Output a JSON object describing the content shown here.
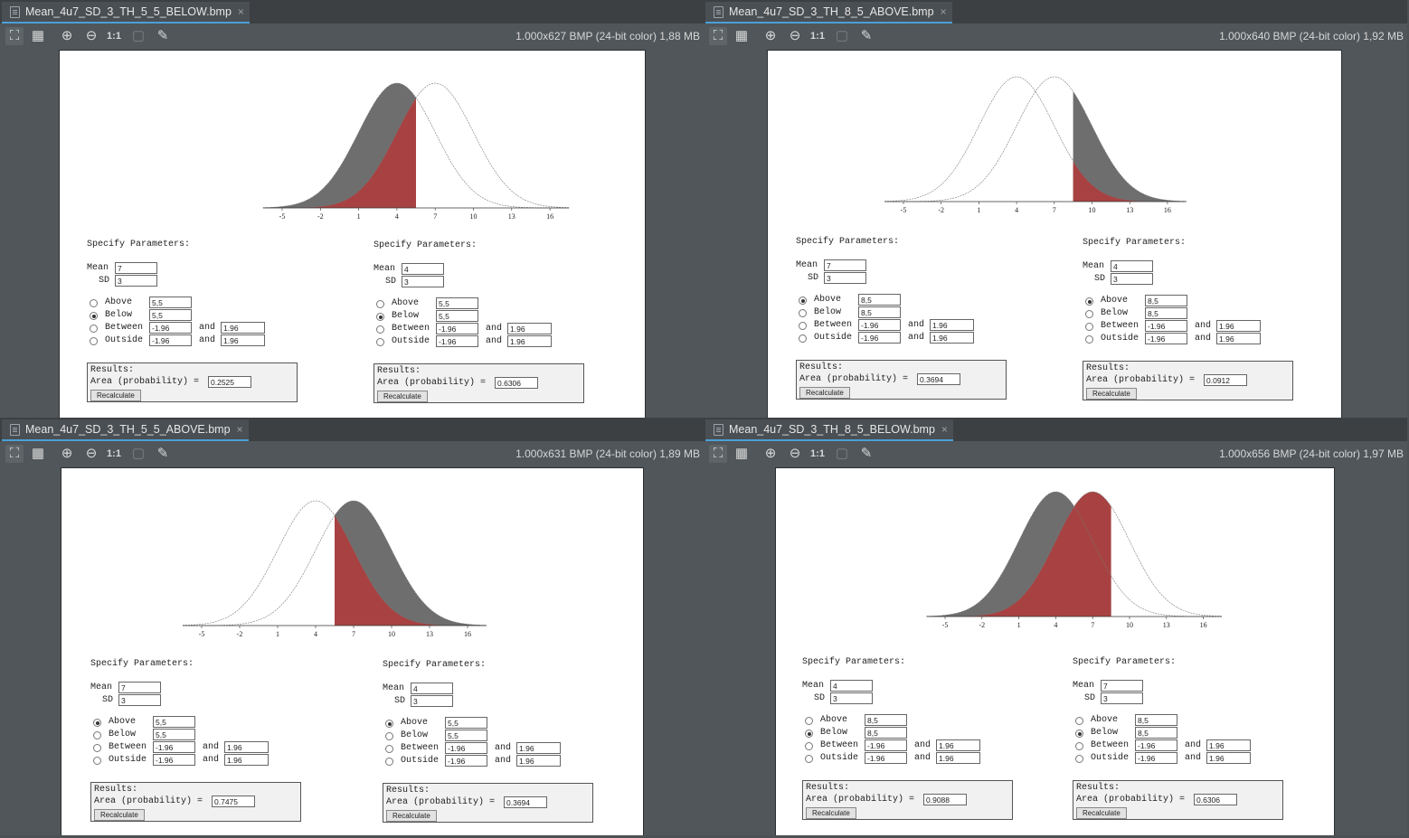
{
  "toolbar_icons": [
    "fit-icon",
    "grid-icon",
    "zoom-in-icon",
    "zoom-out-icon",
    "actual-size-icon",
    "crop-icon",
    "eyedropper-icon"
  ],
  "toolbar_actual_size_label": "1:1",
  "colors": {
    "dark_fill": "#6e6e6e",
    "red_fill": "#a84242",
    "tab_accent": "#4a9fd6"
  },
  "axis_ticks": [
    "-5",
    "-2",
    "1",
    "4",
    "7",
    "10",
    "13",
    "16"
  ],
  "form_labels": {
    "specify": "Specify Parameters:",
    "mean": "Mean",
    "sd": "SD",
    "above": "Above",
    "below": "Below",
    "between": "Between",
    "outside": "Outside",
    "and": "and",
    "results": "Results:",
    "area": "Area (probability) =",
    "recalc": "Recalculate"
  },
  "panes": [
    {
      "tab": "Mean_4u7_SD_3_TH_5_5_BELOW.bmp",
      "info": "1.000x627 BMP (24-bit color) 1,88 MB",
      "chart_data": {
        "type": "area",
        "distributions": [
          {
            "name": "",
            "mean": 4,
            "sd": 3
          },
          {
            "name": "",
            "mean": 7,
            "sd": 3
          }
        ],
        "threshold": 5.5,
        "region": "below",
        "x_ticks": [
          -5,
          -2,
          1,
          4,
          7,
          10,
          13,
          16
        ]
      },
      "forms": [
        {
          "mean": "7",
          "sd": "3",
          "above": "5,5",
          "below": "5,5",
          "between_lo": "-1.96",
          "between_hi": "1.96",
          "outside_lo": "-1.96",
          "outside_hi": "1.96",
          "selected": "below",
          "area": "0.2525"
        },
        {
          "mean": "4",
          "sd": "3",
          "above": "5,5",
          "below": "5,5",
          "between_lo": "-1.96",
          "between_hi": "1.96",
          "outside_lo": "-1.96",
          "outside_hi": "1.96",
          "selected": "below",
          "area": "0.6306"
        }
      ]
    },
    {
      "tab": "Mean_4u7_SD_3_TH_8_5_ABOVE.bmp",
      "info": "1.000x640 BMP (24-bit color) 1,92 MB",
      "chart_data": {
        "type": "area",
        "distributions": [
          {
            "name": "",
            "mean": 4,
            "sd": 3
          },
          {
            "name": "",
            "mean": 7,
            "sd": 3
          }
        ],
        "threshold": 8.5,
        "region": "above",
        "x_ticks": [
          -5,
          -2,
          1,
          4,
          7,
          10,
          13,
          16
        ]
      },
      "forms": [
        {
          "mean": "7",
          "sd": "3",
          "above": "8,5",
          "below": "8,5",
          "between_lo": "-1.96",
          "between_hi": "1.96",
          "outside_lo": "-1.96",
          "outside_hi": "1.96",
          "selected": "above",
          "area": "0.3694"
        },
        {
          "mean": "4",
          "sd": "3",
          "above": "8,5",
          "below": "8,5",
          "between_lo": "-1.96",
          "between_hi": "1.96",
          "outside_lo": "-1.96",
          "outside_hi": "1.96",
          "selected": "above",
          "area": "0.0912"
        }
      ]
    },
    {
      "tab": "Mean_4u7_SD_3_TH_5_5_ABOVE.bmp",
      "info": "1.000x631 BMP (24-bit color) 1,89 MB",
      "chart_data": {
        "type": "area",
        "distributions": [
          {
            "name": "",
            "mean": 4,
            "sd": 3
          },
          {
            "name": "",
            "mean": 7,
            "sd": 3
          }
        ],
        "threshold": 5.5,
        "region": "above",
        "x_ticks": [
          -5,
          -2,
          1,
          4,
          7,
          10,
          13,
          16
        ]
      },
      "forms": [
        {
          "mean": "7",
          "sd": "3",
          "above": "5,5",
          "below": "5,5",
          "between_lo": "-1.96",
          "between_hi": "1.96",
          "outside_lo": "-1.96",
          "outside_hi": "1.96",
          "selected": "above",
          "area": "0.7475"
        },
        {
          "mean": "4",
          "sd": "3",
          "above": "5,5",
          "below": "5,5",
          "between_lo": "-1.96",
          "between_hi": "1.96",
          "outside_lo": "-1.96",
          "outside_hi": "1.96",
          "selected": "above",
          "area": "0.3694"
        }
      ]
    },
    {
      "tab": "Mean_4u7_SD_3_TH_8_5_BELOW.bmp",
      "info": "1.000x656 BMP (24-bit color) 1,97 MB",
      "chart_data": {
        "type": "area",
        "distributions": [
          {
            "name": "",
            "mean": 4,
            "sd": 3
          },
          {
            "name": "",
            "mean": 7,
            "sd": 3
          }
        ],
        "threshold": 8.5,
        "region": "below",
        "x_ticks": [
          -5,
          -2,
          1,
          4,
          7,
          10,
          13,
          16
        ]
      },
      "forms": [
        {
          "mean": "4",
          "sd": "3",
          "above": "8,5",
          "below": "8,5",
          "between_lo": "-1.96",
          "between_hi": "1.96",
          "outside_lo": "-1.96",
          "outside_hi": "1.96",
          "selected": "below",
          "area": "0.9088"
        },
        {
          "mean": "7",
          "sd": "3",
          "above": "8,5",
          "below": "8,5",
          "between_lo": "-1.96",
          "between_hi": "1.96",
          "outside_lo": "-1.96",
          "outside_hi": "1.96",
          "selected": "below",
          "area": "0.6306"
        }
      ]
    }
  ]
}
